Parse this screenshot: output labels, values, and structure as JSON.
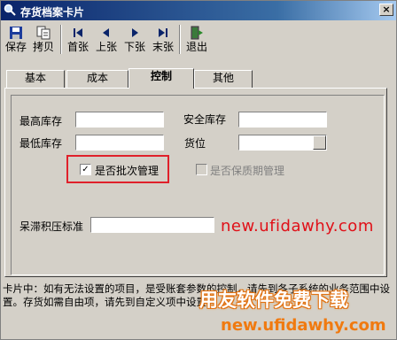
{
  "window": {
    "title": "存货档案卡片",
    "close": "×"
  },
  "toolbar": {
    "save": "保存",
    "copy": "拷贝",
    "first": "首张",
    "prev": "上张",
    "next": "下张",
    "last": "末张",
    "exit": "退出"
  },
  "tabs": [
    "基本",
    "成本",
    "控制",
    "其他"
  ],
  "active_tab": "控制",
  "form": {
    "max_stock_label": "最高库存",
    "max_stock_value": "",
    "safety_stock_label": "安全库存",
    "safety_stock_value": "",
    "min_stock_label": "最低库存",
    "min_stock_value": "",
    "location_label": "货位",
    "location_value": "",
    "batch_label": "是否批次管理",
    "batch_checked": true,
    "batch_mark": "✓",
    "shelf_life_label": "是否保质期管理",
    "shelf_life_checked": false,
    "stagnant_label": "呆滞积压标准",
    "stagnant_value": ""
  },
  "watermark": {
    "url_red": "new.ufidawhy.com",
    "brand_cn": "用友软件免费下载",
    "url_orange": "new.ufidawhy.com"
  },
  "note": "卡片中：如有无法设置的项目，是受账套参数的控制，请先到各子系统的业务范围中设置。存货如需自由项，请先到自定义项中设置。",
  "colors": {
    "highlight": "#e0202a",
    "title_bar": "#0a246a",
    "watermark_orange": "#f07a10"
  }
}
